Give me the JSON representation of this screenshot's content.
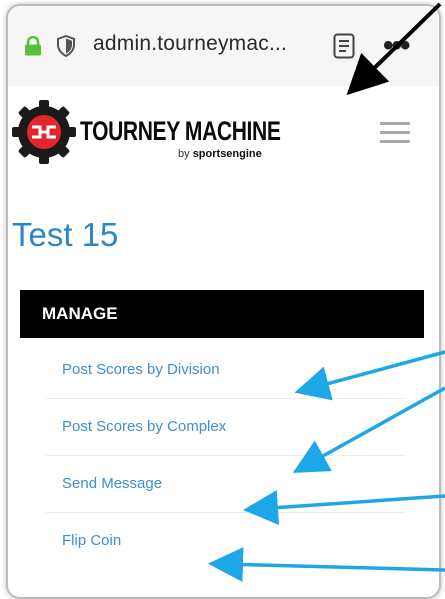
{
  "browser": {
    "url": "admin.tourneymac...",
    "more_label": "•••"
  },
  "header": {
    "brand": "TOURNEY MACHINE",
    "byline_prefix": "by ",
    "byline_brand": "sportsengine"
  },
  "page": {
    "title": "Test 15"
  },
  "manage": {
    "heading": "MANAGE",
    "items": [
      {
        "label": "Post Scores by Division"
      },
      {
        "label": "Post Scores by Complex"
      },
      {
        "label": "Send Message"
      },
      {
        "label": "Flip Coin"
      }
    ]
  },
  "colors": {
    "accent": "#2b86c9",
    "link": "#3d8fcf",
    "arrow_blue": "#1ea7e8",
    "arrow_black": "#000000",
    "lock_green": "#58c13a"
  }
}
